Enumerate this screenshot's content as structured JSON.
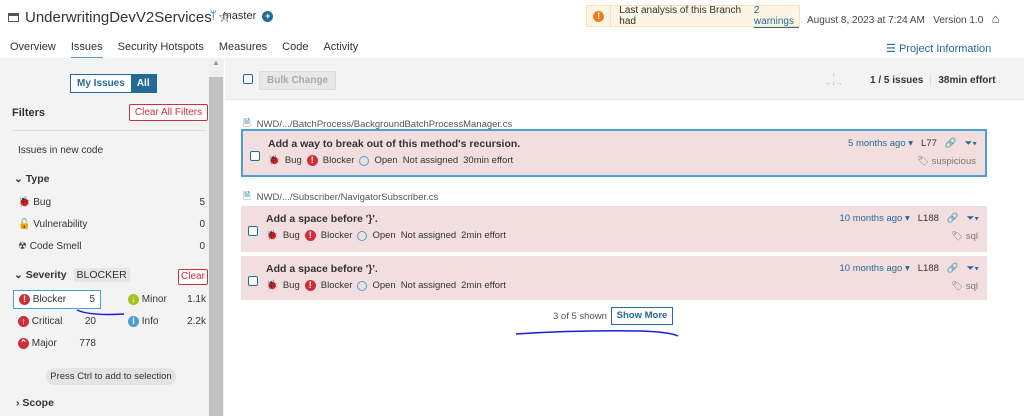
{
  "header": {
    "project": "UnderwritingDevV2Services",
    "branch": "master",
    "warning_text": "Last analysis of this Branch had ",
    "warning_link": "2 warnings",
    "date": "August 8, 2023 at 7:24 AM",
    "version": "Version 1.0"
  },
  "tabs": [
    "Overview",
    "Issues",
    "Security Hotspots",
    "Measures",
    "Code",
    "Activity"
  ],
  "project_info": "Project Information",
  "sidebar": {
    "my_issues": "My Issues",
    "all": "All",
    "filters": "Filters",
    "clear_all": "Clear All Filters",
    "new_code": "Issues in new code",
    "type_label": "Type",
    "types": [
      {
        "label": "Bug",
        "count": "5"
      },
      {
        "label": "Vulnerability",
        "count": "0"
      },
      {
        "label": "Code Smell",
        "count": "0"
      }
    ],
    "severity_label": "Severity",
    "severity_badge": "BLOCKER",
    "clear": "Clear",
    "severities": [
      {
        "label": "Blocker",
        "count": "5"
      },
      {
        "label": "Critical",
        "count": "20"
      },
      {
        "label": "Major",
        "count": "778"
      },
      {
        "label": "Minor",
        "count": "1.1k"
      },
      {
        "label": "Info",
        "count": "2.2k"
      }
    ],
    "hint": "Press Ctrl to add to selection",
    "scope": "Scope"
  },
  "toolbar": {
    "bulk": "Bulk Change",
    "count": "1 / 5 issues",
    "effort": "38min effort"
  },
  "files": [
    "NWD/.../BatchProcess/BackgroundBatchProcessManager.cs",
    "NWD/.../Subscriber/NavigatorSubscriber.cs"
  ],
  "issues": [
    {
      "title": "Add a way to break out of this method's recursion.",
      "type": "Bug",
      "severity": "Blocker",
      "status": "Open",
      "assignee": "Not assigned",
      "effort": "30min effort",
      "age": "5 months ago",
      "line": "L77",
      "tag": "suspicious"
    },
    {
      "title": "Add a space before '}'.",
      "type": "Bug",
      "severity": "Blocker",
      "status": "Open",
      "assignee": "Not assigned",
      "effort": "2min effort",
      "age": "10 months ago",
      "line": "L188",
      "tag": "sql"
    },
    {
      "title": "Add a space before '}'.",
      "type": "Bug",
      "severity": "Blocker",
      "status": "Open",
      "assignee": "Not assigned",
      "effort": "2min effort",
      "age": "10 months ago",
      "line": "L188",
      "tag": "sql"
    }
  ],
  "footer": {
    "shown": "3 of 5 shown",
    "show_more": "Show More"
  }
}
